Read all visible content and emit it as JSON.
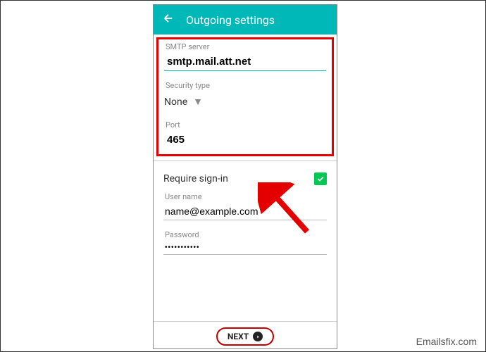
{
  "header": {
    "title": "Outgoing settings"
  },
  "fields": {
    "smtp": {
      "label": "SMTP server",
      "value": "smtp.mail.att.net"
    },
    "security": {
      "label": "Security type",
      "value": "None"
    },
    "port": {
      "label": "Port",
      "value": "465"
    },
    "signin": {
      "label": "Require sign-in"
    },
    "username": {
      "label": "User name",
      "value": "name@example.com"
    },
    "password": {
      "label": "Password",
      "value": "•••••••••••"
    }
  },
  "actions": {
    "next": "NEXT"
  },
  "watermark": "Emailsfix.com"
}
